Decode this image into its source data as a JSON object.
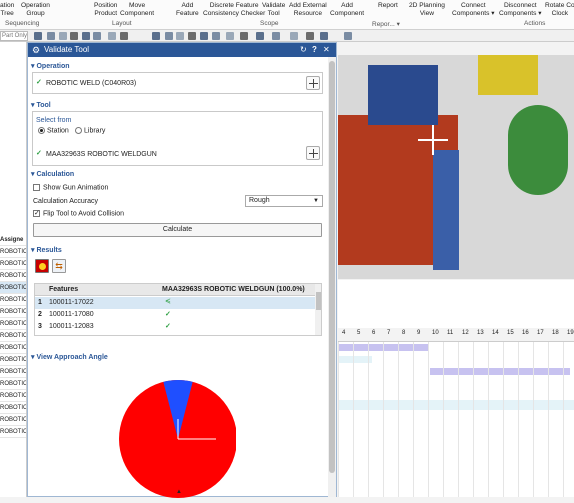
{
  "ribbon": {
    "buttons": [
      "ation\nTree",
      "Operation\nGroup",
      "Position\nProduct",
      "Move\nComponent",
      "Add\nFeature",
      "Discrete Feature\nConsistency Checker",
      "Validate\nTool",
      "Add External\nResource",
      "Add\nComponent",
      "Report",
      "2D Planning\nView",
      "Connect\nComponents ▾",
      "Disconnect\nComponents ▾",
      "Rotate Co\nClock"
    ],
    "groups": [
      "Sequencing",
      "Layout",
      "Scope",
      "Repor... ▾",
      "Actions"
    ]
  },
  "quickbar": {
    "part_filter": "Part Only"
  },
  "left_list": {
    "header": "Assigne",
    "rows": [
      "ROBOTIC",
      "ROBOTIC",
      "ROBOTIC",
      "ROBOTIC",
      "ROBOTIC",
      "ROBOTIC",
      "ROBOTIC",
      "ROBOTIC",
      "ROBOTIC",
      "ROBOTIC",
      "ROBOTIC",
      "ROBOTIC",
      "ROBOTIC",
      "ROBOTIC",
      "ROBOTIC",
      "ROBOTIC"
    ]
  },
  "dialog": {
    "title": "Validate Tool",
    "title_icons": [
      "↻",
      "?",
      "✕"
    ],
    "operation": {
      "header": "Operation",
      "value": "ROBOTIC WELD (C040R03)"
    },
    "tool": {
      "header": "Tool",
      "select_from_label": "Select from",
      "station_label": "Station",
      "library_label": "Library",
      "value": "MAA32963S ROBOTIC WELDGUN"
    },
    "calculation": {
      "header": "Calculation",
      "show_gun_label": "Show Gun Animation",
      "accuracy_label": "Calculation Accuracy",
      "accuracy_value": "Rough",
      "flip_label": "Flip Tool to Avoid Collision",
      "calculate_label": "Calculate"
    },
    "results": {
      "header": "Results",
      "col_features": "Features",
      "col_tool": "MAA32963S ROBOTIC WELDGUN (100.0%)",
      "rows": [
        {
          "num": "1",
          "feature": "100011-17022"
        },
        {
          "num": "2",
          "feature": "100011-17080"
        },
        {
          "num": "3",
          "feature": "100011-12083"
        }
      ]
    },
    "approach": {
      "header": "View Approach Angle"
    }
  },
  "colors": {
    "accent": "#2b5797",
    "pie_main": "#ff0000",
    "pie_slice": "#1f4fff"
  },
  "approach_pie": {
    "slices": [
      {
        "fraction": 0.92
      },
      {
        "fraction": 0.08
      }
    ]
  },
  "gantt": {
    "columns": [
      "4",
      "5",
      "6",
      "7",
      "8",
      "9",
      "10",
      "11",
      "12",
      "13",
      "14",
      "15",
      "16",
      "17",
      "18",
      "19"
    ]
  }
}
